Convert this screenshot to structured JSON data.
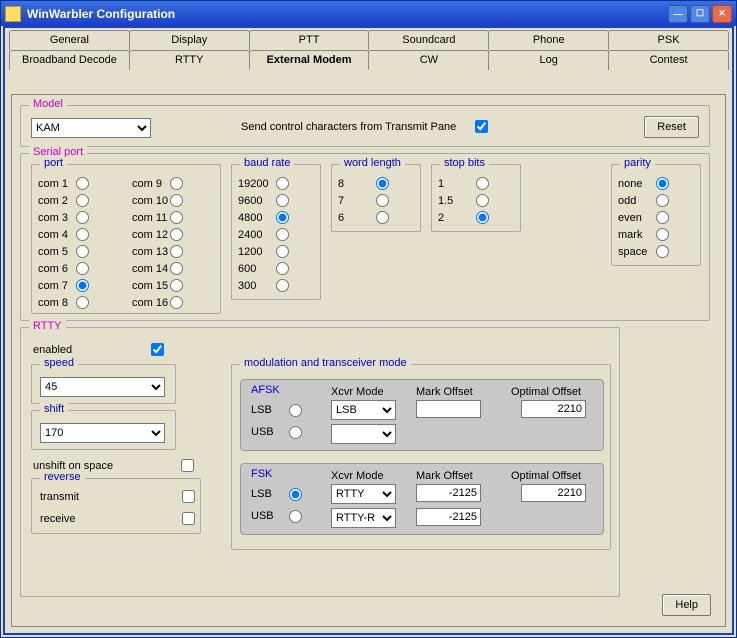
{
  "window": {
    "title": "WinWarbler Configuration"
  },
  "tabs_row1": [
    "General",
    "Display",
    "PTT",
    "Soundcard",
    "Phone",
    "PSK"
  ],
  "tabs_row2": [
    "Broadband Decode",
    "RTTY",
    "External Modem",
    "CW",
    "Log",
    "Contest"
  ],
  "active_tab": "External Modem",
  "model": {
    "legend": "Model",
    "selected": "KAM",
    "send_ctrl_label": "Send control characters from Transmit Pane",
    "send_ctrl_checked": true,
    "reset_label": "Reset"
  },
  "serial": {
    "legend": "Serial port",
    "port": {
      "legend": "port",
      "cols": [
        [
          "com 1",
          "com 2",
          "com 3",
          "com 4",
          "com 5",
          "com 6",
          "com 7",
          "com 8"
        ],
        [
          "com 9",
          "com 10",
          "com 11",
          "com 12",
          "com 13",
          "com 14",
          "com 15",
          "com 16"
        ]
      ],
      "selected": "com 7"
    },
    "baud": {
      "legend": "baud rate",
      "items": [
        "19200",
        "9600",
        "4800",
        "2400",
        "1200",
        "600",
        "300"
      ],
      "selected": "4800"
    },
    "word": {
      "legend": "word length",
      "items": [
        "8",
        "7",
        "6"
      ],
      "selected": "8"
    },
    "stop": {
      "legend": "stop bits",
      "items": [
        "1",
        "1.5",
        "2"
      ],
      "selected": "2"
    },
    "parity": {
      "legend": "parity",
      "items": [
        "none",
        "odd",
        "even",
        "mark",
        "space"
      ],
      "selected": "none"
    }
  },
  "rtty": {
    "legend": "RTTY",
    "enabled_label": "enabled",
    "enabled": true,
    "speed": {
      "legend": "speed",
      "value": "45"
    },
    "shift": {
      "legend": "shift",
      "value": "170"
    },
    "unshift_label": "unshift on space",
    "unshift": false,
    "reverse": {
      "legend": "reverse",
      "transmit_label": "transmit",
      "transmit": false,
      "receive_label": "receive",
      "receive": false
    },
    "mod": {
      "legend": "modulation and transceiver mode",
      "afsk": {
        "legend": "AFSK",
        "lsb_label": "LSB",
        "usb_label": "USB",
        "selected": "",
        "xcvr_label": "Xcvr Mode",
        "xcvr_lsb": "LSB",
        "xcvr_usb": "",
        "mark_label": "Mark Offset",
        "mark": "",
        "opt_label": "Optimal Offset",
        "opt": "2210"
      },
      "fsk": {
        "legend": "FSK",
        "lsb_label": "LSB",
        "usb_label": "USB",
        "selected": "LSB",
        "xcvr_label": "Xcvr Mode",
        "xcvr_lsb": "RTTY",
        "xcvr_usb": "RTTY-R",
        "mark_label": "Mark Offset",
        "mark_lsb": "-2125",
        "mark_usb": "-2125",
        "opt_label": "Optimal Offset",
        "opt": "2210"
      }
    }
  },
  "help_label": "Help"
}
